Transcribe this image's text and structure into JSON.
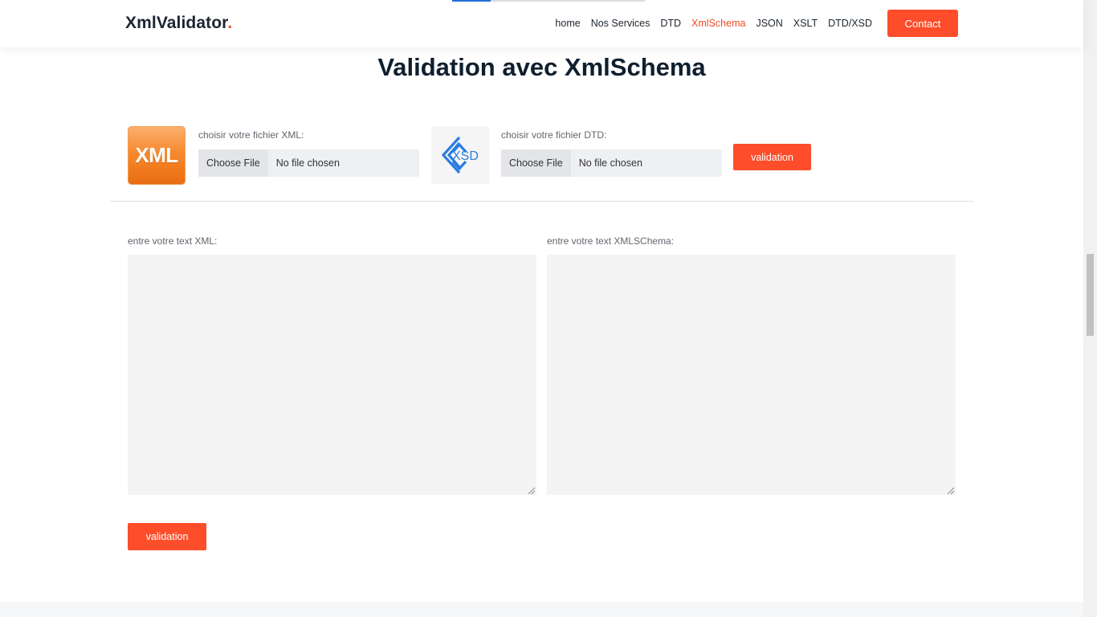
{
  "header": {
    "logo_text": "XmlValidator",
    "logo_dot": ".",
    "nav": [
      "home",
      "Nos Services",
      "DTD",
      "XmlSchema",
      "JSON",
      "XSLT",
      "DTD/XSD"
    ],
    "active_nav": "XmlSchema",
    "contact_label": "Contact"
  },
  "page": {
    "title": "Validation avec XmlSchema"
  },
  "upload": {
    "xml_logo_text": "XML",
    "xsd_logo_text": "XSD",
    "xml_label": "choisir votre fichier XML:",
    "dtd_label": "choisir votre fichier DTD:",
    "choose_file": "Choose File",
    "no_file": "No file chosen",
    "validate_label": "validation"
  },
  "text_inputs": {
    "xml_label": "entre votre text XML:",
    "schema_label": "entre votre text XMLSChema:",
    "xml_value": "",
    "schema_value": "",
    "validate_label": "validation"
  },
  "colors": {
    "accent": "#fd4d2a",
    "title": "#0f1f2e",
    "input_bg": "#f4f4f4"
  }
}
